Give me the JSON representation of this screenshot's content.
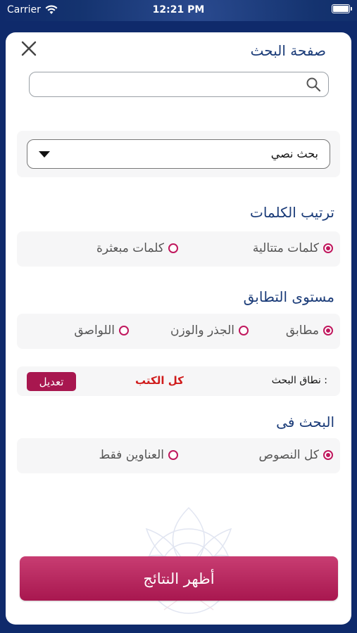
{
  "status_bar": {
    "carrier": "Carrier",
    "time": "12:21 PM"
  },
  "header": {
    "title": "صفحة البحث",
    "close_icon": "close-icon"
  },
  "search": {
    "value": "",
    "placeholder": ""
  },
  "search_type": {
    "selected": "بحث نصي"
  },
  "word_order": {
    "heading": "ترتيب الكلمات",
    "options": [
      {
        "label": "كلمات متتالية",
        "checked": true
      },
      {
        "label": "كلمات مبعثرة",
        "checked": false
      }
    ]
  },
  "match_level": {
    "heading": "مستوى التطابق",
    "options": [
      {
        "label": "مطابق",
        "checked": true
      },
      {
        "label": "الجذر والوزن",
        "checked": false
      },
      {
        "label": "اللواصق",
        "checked": false
      }
    ]
  },
  "search_scope": {
    "label": "نطاق البحث :",
    "value": "كل الكتب",
    "edit_label": "تعديل"
  },
  "search_in": {
    "heading": "البحث فى",
    "options": [
      {
        "label": "كل النصوص",
        "checked": true
      },
      {
        "label": "العناوين فقط",
        "checked": false
      }
    ]
  },
  "actions": {
    "show_results_label": "أظهر النتائج"
  },
  "colors": {
    "accent": "#a8174f",
    "heading": "#1a3b78",
    "background": "#0f2a6b"
  }
}
